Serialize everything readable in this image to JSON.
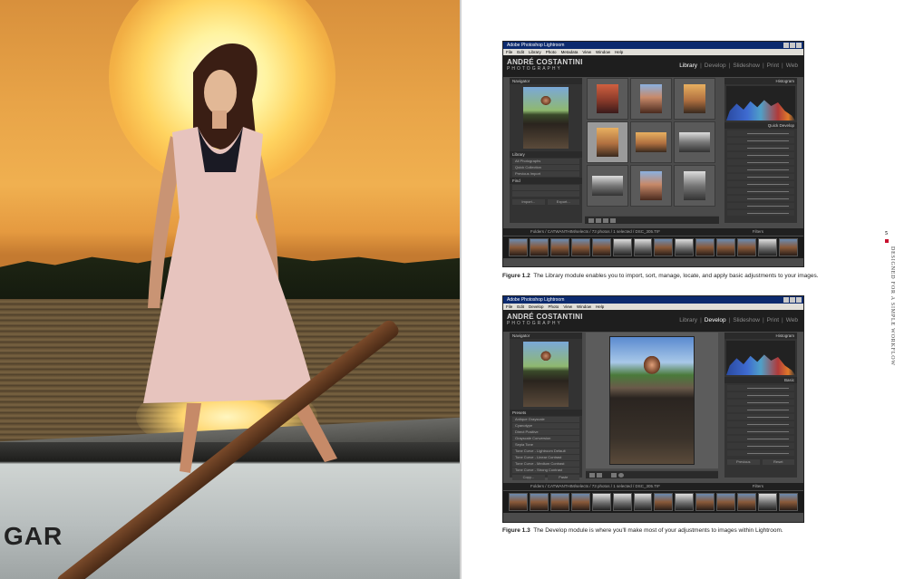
{
  "left_page": {
    "photo": "woman-standing-in-rowboat-at-sunset",
    "boat_text": "GAR"
  },
  "figure_1_2": {
    "window_title": "Adobe Photoshop Lightroom",
    "menu": [
      "File",
      "Edit",
      "Library",
      "Photo",
      "Metadata",
      "View",
      "Window",
      "Help"
    ],
    "brand": "ANDRÉ COSTANTINI",
    "brand_sub": "PHOTOGRAPHY",
    "modules": [
      "Library",
      "Develop",
      "Slideshow",
      "Print",
      "Web"
    ],
    "active_module": "Library",
    "left_panel_title": "Navigator",
    "right_panel_title": "Histogram",
    "library_title": "Library",
    "library_items": [
      "All Photographs",
      "Quick Collection",
      "Previous Import"
    ],
    "find_title": "Find",
    "quick_develop_title": "Quick Develop",
    "import_button": "Import...",
    "export_button": "Export...",
    "filmstrip_path": "Folders / CATWANTHIM/selects / 73 photos / 1 selected / DSC_305.TIF",
    "filters_label": "Filters",
    "caption_label": "Figure 1.2",
    "caption_text": "The Library module enables you to import, sort, manage, locate, and apply basic adjustments to your images."
  },
  "figure_1_3": {
    "window_title": "Adobe Photoshop Lightroom",
    "menu": [
      "File",
      "Edit",
      "Develop",
      "Photo",
      "View",
      "Window",
      "Help"
    ],
    "brand": "ANDRÉ COSTANTINI",
    "brand_sub": "PHOTOGRAPHY",
    "modules": [
      "Library",
      "Develop",
      "Slideshow",
      "Print",
      "Web"
    ],
    "active_module": "Develop",
    "left_panel_title": "Navigator",
    "right_panel_title": "Histogram",
    "presets_title": "Presets",
    "presets": [
      "Antique Grayscale",
      "Cyanotype",
      "Direct Positive",
      "Grayscale Conversion",
      "Sepia Tone",
      "Tone Curve - Lightroom Default",
      "Tone Curve - Linear Contrast",
      "Tone Curve - Medium Contrast",
      "Tone Curve - Strong Contrast"
    ],
    "basic_title": "Basic",
    "copy_button": "Copy...",
    "paste_button": "Paste",
    "previous_button": "Previous",
    "reset_button": "Reset",
    "filmstrip_path": "Folders / CATWANTHIM/selects / 73 photos / 1 selected / DSC_305.TIF",
    "filters_label": "Filters",
    "caption_label": "Figure 1.3",
    "caption_text": "The Develop module is where you'll make most of your adjustments to images within Lightroom."
  },
  "running_head": {
    "page_number": "5",
    "text": "DESIGNED FOR A SIMPLE WORKFLOW"
  }
}
